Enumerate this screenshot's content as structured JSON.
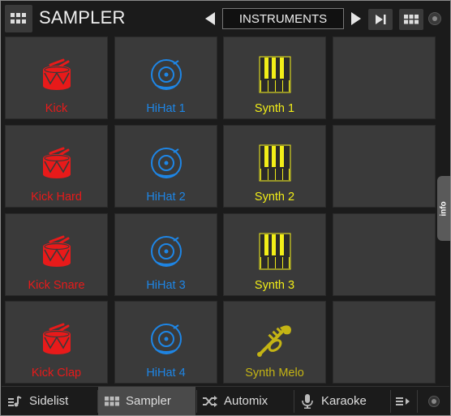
{
  "header": {
    "title": "SAMPLER",
    "category": "INSTRUMENTS",
    "icons": [
      "grid-icon",
      "prev-arrow-icon",
      "next-arrow-icon",
      "skip-end-icon",
      "pads-view-icon",
      "dot-menu-icon"
    ]
  },
  "pads": [
    {
      "label": "Kick",
      "icon": "drum-icon",
      "color": "#e81a1a"
    },
    {
      "label": "HiHat 1",
      "icon": "cymbal-icon",
      "color": "#1e86e6"
    },
    {
      "label": "Synth 1",
      "icon": "keyboard-icon",
      "color": "#f2ee18"
    },
    {
      "label": "",
      "icon": "",
      "color": ""
    },
    {
      "label": "Kick Hard",
      "icon": "drum-icon",
      "color": "#e81a1a"
    },
    {
      "label": "HiHat 2",
      "icon": "cymbal-icon",
      "color": "#1e86e6"
    },
    {
      "label": "Synth 2",
      "icon": "keyboard-icon",
      "color": "#f2ee18"
    },
    {
      "label": "",
      "icon": "",
      "color": ""
    },
    {
      "label": "Kick Snare",
      "icon": "drum-icon",
      "color": "#e81a1a"
    },
    {
      "label": "HiHat 3",
      "icon": "cymbal-icon",
      "color": "#1e86e6"
    },
    {
      "label": "Synth 3",
      "icon": "keyboard-icon",
      "color": "#f2ee18"
    },
    {
      "label": "",
      "icon": "",
      "color": ""
    },
    {
      "label": "Kick Clap",
      "icon": "drum-icon",
      "color": "#e81a1a"
    },
    {
      "label": "HiHat 4",
      "icon": "cymbal-icon",
      "color": "#1e86e6"
    },
    {
      "label": "Synth Melo",
      "icon": "trumpet-icon",
      "color": "#c4b414"
    },
    {
      "label": "",
      "icon": "",
      "color": ""
    }
  ],
  "side_tab": {
    "label": "info"
  },
  "tabs": [
    {
      "label": "Sidelist",
      "icon": "sidelist-icon",
      "active": false
    },
    {
      "label": "Sampler",
      "icon": "grid-icon",
      "active": true
    },
    {
      "label": "Automix",
      "icon": "shuffle-icon",
      "active": false
    },
    {
      "label": "Karaoke",
      "icon": "microphone-icon",
      "active": false
    }
  ],
  "tab_icons": [
    "list-arrow-icon",
    "dot-icon"
  ]
}
